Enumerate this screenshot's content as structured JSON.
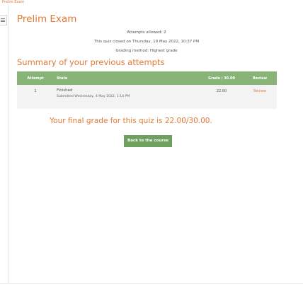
{
  "breadcrumb": "Prelim Exam",
  "page_title": "Prelim Exam",
  "quiz_info": {
    "attempts_allowed": "Attempts allowed: 2",
    "closed_on": "This quiz closed on Thursday, 19 May 2022, 10:37 PM",
    "grading_method": "Grading method: Highest grade"
  },
  "summary_heading": "Summary of your previous attempts",
  "table": {
    "headers": {
      "attempt": "Attempt",
      "state": "State",
      "grade": "Grade / 30.00",
      "review": "Review"
    },
    "rows": [
      {
        "attempt": "1",
        "state": "Finished",
        "submitted": "Submitted Wednesday, 4 May 2022, 1:14 PM",
        "grade": "22.00",
        "review": "Review"
      }
    ]
  },
  "final_grade": "Your final grade for this quiz is 22.00/30.00.",
  "back_button": "Back to the course",
  "colors": {
    "accent": "#e07a36",
    "table_header": "#88b577",
    "button": "#6ea15f"
  }
}
